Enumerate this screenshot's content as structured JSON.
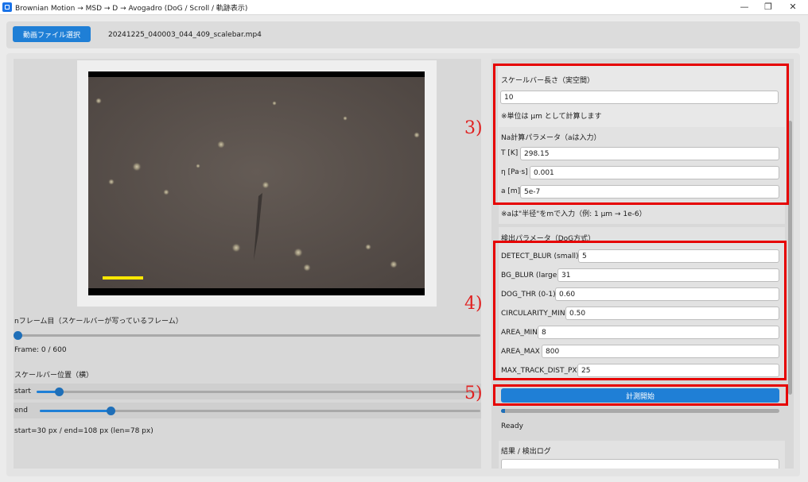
{
  "window": {
    "title": "Brownian Motion → MSD → D → Avogadro (DoG / Scroll / 軌跡表示)",
    "minimize": "—",
    "maximize": "❐",
    "close": "✕"
  },
  "toolbar": {
    "open_button": "動画ファイル選択",
    "filename": "20241225_040003_044_409_scalebar.mp4"
  },
  "left": {
    "frame_label": "nフレーム目（スケールバーが写っているフレーム）",
    "frame_slider": {
      "value": 0,
      "max": 600
    },
    "frame_text": "Frame: 0 / 600",
    "scalebar_pos_label": "スケールバー位置（横）",
    "start_label": "start",
    "end_label": "end",
    "start_slider_fraction": 0.05,
    "end_slider_fraction": 0.16,
    "result_text": "start=30 px / end=108 px (len=78 px)"
  },
  "right": {
    "scale_label": "スケールバー長さ（実空間）",
    "scale_value": "10",
    "scale_note": "※単位は μm として計算します",
    "na_label": "Na計算パラメータ（aは入力）",
    "params": [
      {
        "label": "T [K]",
        "value": "298.15"
      },
      {
        "label": "η [Pa·s]",
        "value": "0.001"
      },
      {
        "label": "a [m]",
        "value": "5e-7"
      }
    ],
    "a_note": "※aは\"半径\"をmで入力（例: 1 μm → 1e-6）",
    "detect_label": "検出パラメータ（DoG方式）",
    "detect_params": [
      {
        "label": "DETECT_BLUR (small)",
        "value": "5"
      },
      {
        "label": "BG_BLUR (large)",
        "value": "31"
      },
      {
        "label": "DOG_THR (0-1)",
        "value": "0.60"
      },
      {
        "label": "CIRCULARITY_MIN",
        "value": "0.50"
      },
      {
        "label": "AREA_MIN",
        "value": "8"
      },
      {
        "label": "AREA_MAX",
        "value": "800"
      },
      {
        "label": "MAX_TRACK_DIST_PX",
        "value": "25"
      }
    ],
    "start_button": "計測開始",
    "progress_fraction": 0.01,
    "status": "Ready",
    "log_label": "結果 / 検出ログ"
  },
  "annotations": {
    "m3": "3)",
    "m4": "4)",
    "m5": "5)"
  },
  "colors": {
    "accent": "#1f7fd6",
    "highlight": "#e60000",
    "scalebar": "#ffe800"
  }
}
